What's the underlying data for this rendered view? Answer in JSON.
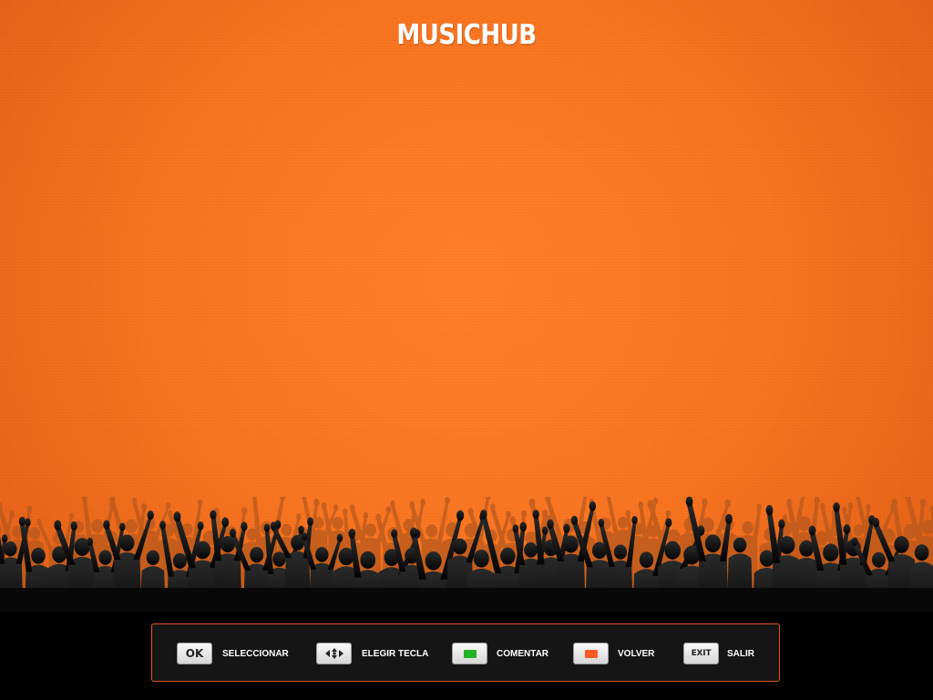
{
  "app": {
    "logo_text": "MUSICHUB"
  },
  "colors": {
    "background_orange": "#f97420",
    "legend_border": "#e2551f",
    "green_key": "#22b224",
    "red_key": "#ff5a2a"
  },
  "legend": {
    "items": [
      {
        "key_text": "OK",
        "key_icon": "ok-key",
        "label": "SELECCIONAR"
      },
      {
        "key_text": "",
        "key_icon": "arrows-icon",
        "label": "ELEGIR TECLA"
      },
      {
        "key_text": "",
        "key_icon": "green-button-icon",
        "label": "COMENTAR"
      },
      {
        "key_text": "",
        "key_icon": "red-button-icon",
        "label": "VOLVER"
      },
      {
        "key_text": "EXIT",
        "key_icon": "exit-key",
        "label": "SALIR"
      }
    ]
  }
}
